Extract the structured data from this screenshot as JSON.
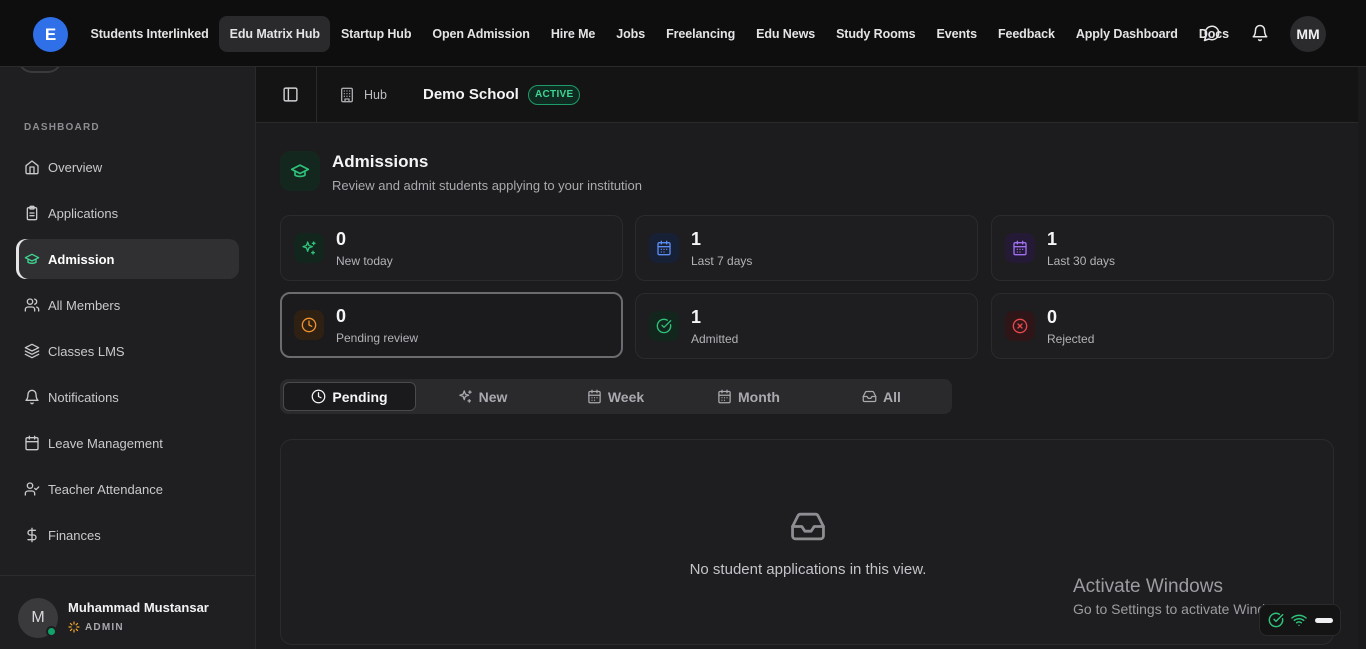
{
  "topnav": {
    "logo_text": "E",
    "links": [
      {
        "label": "Students Interlinked",
        "active": false
      },
      {
        "label": "Edu Matrix Hub",
        "active": true
      },
      {
        "label": "Startup Hub",
        "active": false
      },
      {
        "label": "Open Admission",
        "active": false
      },
      {
        "label": "Hire Me",
        "active": false
      },
      {
        "label": "Jobs",
        "active": false
      },
      {
        "label": "Freelancing",
        "active": false
      },
      {
        "label": "Edu News",
        "active": false
      },
      {
        "label": "Study Rooms",
        "active": false
      },
      {
        "label": "Events",
        "active": false
      },
      {
        "label": "Feedback",
        "active": false
      },
      {
        "label": "Apply Dashboard",
        "active": false
      },
      {
        "label": "Docs",
        "active": false
      }
    ],
    "icons": [
      "message-icon",
      "bell-icon"
    ],
    "avatar_initials": "MM"
  },
  "sidebar": {
    "section_label": "DASHBOARD",
    "items": [
      {
        "label": "Overview",
        "icon": "home-icon"
      },
      {
        "label": "Applications",
        "icon": "clipboard-icon"
      },
      {
        "label": "Admission",
        "icon": "graduation-cap-icon",
        "active": true
      },
      {
        "label": "All Members",
        "icon": "users-icon"
      },
      {
        "label": "Classes LMS",
        "icon": "layers-icon"
      },
      {
        "label": "Notifications",
        "icon": "bell-icon"
      },
      {
        "label": "Leave Management",
        "icon": "calendar-icon"
      },
      {
        "label": "Teacher Attendance",
        "icon": "user-check-icon"
      },
      {
        "label": "Finances",
        "icon": "dollar-icon"
      }
    ],
    "user": {
      "initial": "M",
      "name": "Muhammad Mustansar",
      "role": "ADMIN"
    }
  },
  "header": {
    "hub_label": "Hub",
    "school_name": "Demo School",
    "status_badge": "ACTIVE"
  },
  "page": {
    "title": "Admissions",
    "subtitle": "Review and admit students applying to your institution"
  },
  "stats": [
    {
      "value": "0",
      "label": "New today",
      "icon": "sparkles-icon",
      "color": "#2fc27a"
    },
    {
      "value": "1",
      "label": "Last 7 days",
      "icon": "calendar-icon",
      "color": "#5b8cf0"
    },
    {
      "value": "1",
      "label": "Last 30 days",
      "icon": "calendar-icon",
      "color": "#a070f0"
    },
    {
      "value": "0",
      "label": "Pending review",
      "icon": "clock-icon",
      "color": "#f0922e",
      "selected": true
    },
    {
      "value": "1",
      "label": "Admitted",
      "icon": "check-circle-icon",
      "color": "#2fc27a"
    },
    {
      "value": "0",
      "label": "Rejected",
      "icon": "x-circle-icon",
      "color": "#e8484e"
    }
  ],
  "tabs": [
    {
      "label": "Pending",
      "icon": "clock-icon",
      "active": true
    },
    {
      "label": "New",
      "icon": "sparkles-icon"
    },
    {
      "label": "Week",
      "icon": "calendar-icon"
    },
    {
      "label": "Month",
      "icon": "calendar-icon"
    },
    {
      "label": "All",
      "icon": "inbox-icon"
    }
  ],
  "empty_state": {
    "message": "No student applications in this view.",
    "icon": "inbox-icon"
  },
  "watermark": {
    "title": "Activate Windows",
    "subtitle": "Go to Settings to activate Windows."
  }
}
